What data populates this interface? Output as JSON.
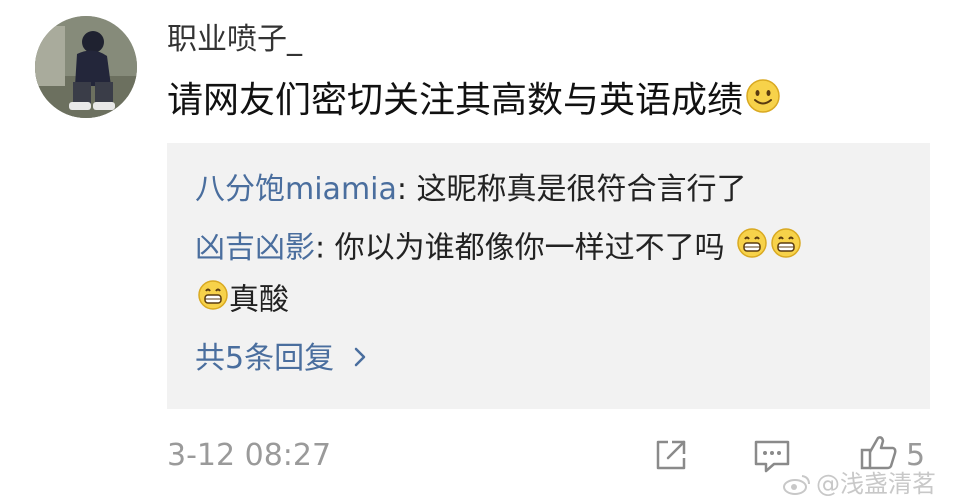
{
  "comment": {
    "username": "职业喷子_",
    "text": "请网友们密切关注其高数与英语成绩",
    "emoji": "smile-emoji"
  },
  "replies": [
    {
      "name": "八分饱miamia",
      "separator": ": ",
      "text": "这昵称真是很符合言行了"
    },
    {
      "name": "凶吉凶影",
      "separator": ": ",
      "text": "你以为谁都像你一样过不了吗",
      "text2": "真酸",
      "emoji": "grin-emoji"
    }
  ],
  "replies_more": "共5条回复",
  "meta": {
    "timestamp": "3-12 08:27",
    "like_count": "5"
  },
  "watermark": "@浅盏清茗",
  "colors": {
    "link": "#4a6e9e",
    "meta": "#9a9a9a",
    "reply_bg": "#f2f2f2"
  }
}
